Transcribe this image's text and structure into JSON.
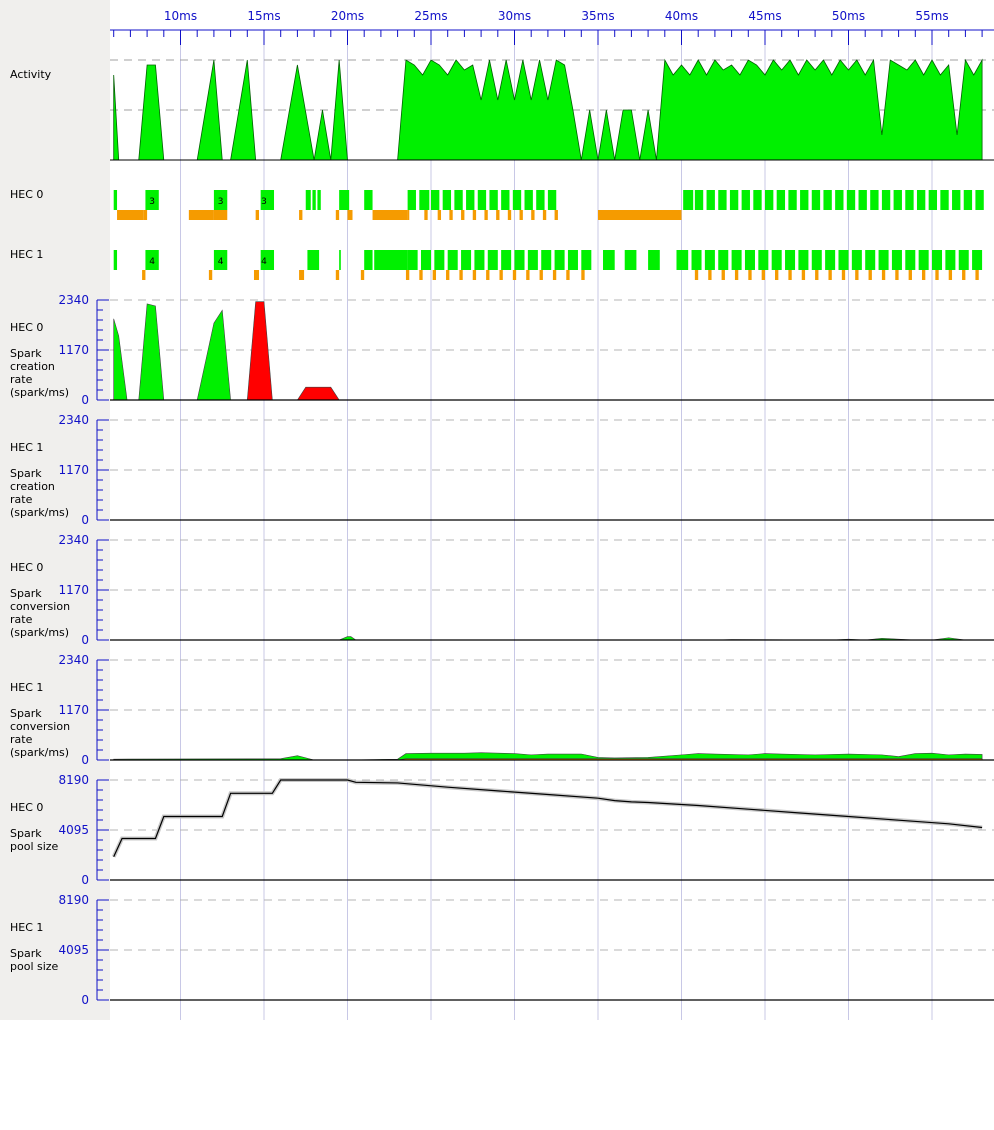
{
  "timeline": {
    "tick_labels": [
      "ms",
      "10ms",
      "15ms",
      "20ms",
      "25ms",
      "30ms",
      "35ms",
      "40ms",
      "45ms",
      "50ms",
      "55ms"
    ],
    "x_unit": "ms"
  },
  "rows": {
    "activity_label": "Activity",
    "hec0_label": "HEC 0",
    "hec1_label": "HEC 1"
  },
  "graph_labels": [
    {
      "hec": "HEC 0",
      "metric": "Spark\ncreation\nrate\n(spark/ms)"
    },
    {
      "hec": "HEC 1",
      "metric": "Spark\ncreation\nrate\n(spark/ms)"
    },
    {
      "hec": "HEC 0",
      "metric": "Spark\nconversion\nrate\n(spark/ms)"
    },
    {
      "hec": "HEC 1",
      "metric": "Spark\nconversion\nrate\n(spark/ms)"
    },
    {
      "hec": "HEC 0",
      "metric": "Spark\npool size"
    },
    {
      "hec": "HEC 1",
      "metric": "Spark\npool size"
    }
  ],
  "colors": {
    "running": "#00f000",
    "gc": "#f59b00",
    "overflow": "#ff0000",
    "axis": "#1010c8",
    "sidebar": "#f0efed"
  },
  "chart_data": [
    {
      "type": "area",
      "title": "Activity",
      "x": [
        6,
        6.3,
        6.8,
        7.5,
        8,
        8.5,
        9,
        10,
        11,
        12,
        12.5,
        13,
        14,
        14.5,
        15,
        16,
        17,
        18,
        18.5,
        19,
        19.5,
        20,
        20.5,
        21,
        22,
        23,
        23.5,
        24,
        24.5,
        25,
        25.5,
        26,
        26.5,
        27,
        27.5,
        28,
        28.5,
        29,
        29.5,
        30,
        30.5,
        31,
        31.5,
        32,
        32.5,
        33,
        33.5,
        34,
        34.5,
        35,
        35.5,
        36,
        36.5,
        37,
        37.5,
        38,
        38.5,
        39,
        39.5,
        40,
        40.5,
        41,
        41.5,
        42,
        42.5,
        43,
        43.5,
        44,
        44.5,
        45,
        45.5,
        46,
        46.5,
        47,
        47.5,
        48,
        48.5,
        49,
        49.5,
        50,
        50.5,
        51,
        51.5,
        52,
        52.5,
        53,
        53.5,
        54,
        54.5,
        55,
        55.5,
        56,
        56.5,
        57,
        57.5,
        58
      ],
      "y": [
        0.85,
        0,
        0,
        0,
        0.95,
        0.95,
        0,
        0,
        0,
        1,
        0,
        0,
        1,
        0,
        0,
        0,
        0.95,
        0,
        0.5,
        0,
        1,
        0,
        0,
        0,
        0,
        0,
        1,
        0.95,
        0.85,
        1,
        0.95,
        0.85,
        1,
        0.9,
        0.95,
        0.6,
        1,
        0.6,
        1,
        0.6,
        1,
        0.6,
        1,
        0.6,
        1,
        0.95,
        0.5,
        0,
        0.5,
        0,
        0.5,
        0,
        0.5,
        0.5,
        0,
        0.5,
        0,
        1,
        0.85,
        0.95,
        0.85,
        1,
        0.85,
        1,
        0.9,
        0.95,
        0.85,
        1,
        0.95,
        0.85,
        1,
        0.9,
        1,
        0.85,
        1,
        0.9,
        1,
        0.85,
        1,
        0.9,
        1,
        0.85,
        1,
        0.25,
        1,
        0.95,
        0.9,
        1,
        0.85,
        1,
        0.85,
        0.95,
        0.25,
        1,
        0.85,
        1
      ],
      "ylim": [
        0,
        1
      ],
      "grid": true
    },
    {
      "type": "line",
      "hec": "HEC 0",
      "metric": "Spark creation rate (spark/ms)",
      "ticks": [
        "2340",
        "1170",
        "0"
      ],
      "ylim": [
        0,
        2340
      ],
      "series": [
        {
          "color": "#00f000",
          "x": [
            6,
            6.3,
            6.8,
            7.5,
            8,
            8.5,
            9,
            10,
            11,
            12,
            12.5,
            13,
            14,
            14.5,
            15,
            15.5,
            16,
            19,
            20
          ],
          "y": [
            1900,
            1500,
            0,
            0,
            2250,
            2200,
            0,
            0,
            0,
            1800,
            2100,
            0,
            0,
            1200,
            1200,
            0,
            0,
            0,
            0
          ]
        },
        {
          "color": "#ff0000",
          "x": [
            14,
            14.5,
            15,
            15.5,
            16,
            17,
            17.5,
            19,
            19.5
          ],
          "y": [
            0,
            2300,
            2300,
            0,
            0,
            0,
            300,
            300,
            0
          ]
        }
      ]
    },
    {
      "type": "line",
      "hec": "HEC 1",
      "metric": "Spark creation rate (spark/ms)",
      "ticks": [
        "2340",
        "1170",
        "0"
      ],
      "ylim": [
        0,
        2340
      ],
      "series": []
    },
    {
      "type": "line",
      "hec": "HEC 0",
      "metric": "Spark conversion rate (spark/ms)",
      "ticks": [
        "2340",
        "1170",
        "0"
      ],
      "ylim": [
        0,
        2340
      ],
      "series": [
        {
          "color": "#00f000",
          "x": [
            19.5,
            20,
            20.2,
            20.5,
            25,
            38,
            42,
            43,
            49,
            50,
            51,
            52,
            54,
            55,
            56,
            57,
            58
          ],
          "y": [
            0,
            80,
            80,
            0,
            0,
            0,
            0,
            10,
            0,
            20,
            0,
            40,
            0,
            0,
            50,
            0,
            0
          ]
        }
      ]
    },
    {
      "type": "line",
      "hec": "HEC 1",
      "metric": "Spark conversion rate (spark/ms)",
      "ticks": [
        "2340",
        "1170",
        "0"
      ],
      "ylim": [
        0,
        2340
      ],
      "series": [
        {
          "color": "#00f000",
          "x": [
            6,
            16,
            17,
            18,
            20,
            23,
            23.5,
            25,
            27,
            28,
            30,
            31,
            32,
            34,
            35,
            36,
            38,
            40,
            41,
            42,
            44,
            45,
            46,
            48,
            50,
            52,
            53,
            54,
            55,
            56,
            57,
            58
          ],
          "y": [
            20,
            30,
            100,
            0,
            0,
            20,
            150,
            160,
            160,
            170,
            150,
            120,
            140,
            140,
            60,
            50,
            60,
            120,
            150,
            140,
            120,
            150,
            140,
            120,
            140,
            120,
            80,
            150,
            160,
            120,
            140,
            130
          ]
        },
        {
          "color": "#f59b00",
          "x": [
            20,
            23,
            23.5,
            58
          ],
          "y": [
            0,
            0,
            30,
            30
          ]
        }
      ]
    },
    {
      "type": "line",
      "hec": "HEC 0",
      "metric": "Spark pool size",
      "ticks": [
        "8190",
        "4095",
        "0"
      ],
      "ylim": [
        0,
        8190
      ],
      "series": [
        {
          "color": "#000000",
          "x": [
            6,
            6.5,
            8.5,
            9,
            12.5,
            13,
            15.5,
            16,
            20,
            20.5,
            23,
            26,
            29,
            32,
            35,
            36,
            37,
            38,
            41,
            44,
            47,
            50,
            53,
            56,
            58
          ],
          "y": [
            1900,
            3400,
            3400,
            5200,
            5200,
            7100,
            7100,
            8190,
            8190,
            8000,
            7950,
            7600,
            7300,
            7000,
            6700,
            6500,
            6400,
            6350,
            6100,
            5800,
            5500,
            5200,
            4900,
            4600,
            4300
          ]
        }
      ]
    },
    {
      "type": "line",
      "hec": "HEC 1",
      "metric": "Spark pool size",
      "ticks": [
        "8190",
        "4095",
        "0"
      ],
      "ylim": [
        0,
        8190
      ],
      "series": []
    },
    {
      "type": "timeline",
      "hec": "HEC 0",
      "running": [
        [
          6,
          6.2
        ],
        [
          7.9,
          8.7
        ],
        [
          12,
          12.8
        ],
        [
          14.8,
          15.6
        ],
        [
          17.5,
          17.8
        ],
        [
          17.9,
          18.1
        ],
        [
          18.2,
          18.4
        ],
        [
          19.5,
          20.1
        ],
        [
          21,
          21.5
        ],
        [
          23.6,
          24.1
        ],
        [
          24.3,
          24.9
        ],
        [
          25,
          25.5
        ],
        [
          25.7,
          26.2
        ],
        [
          26.4,
          26.9
        ],
        [
          27.1,
          27.6
        ],
        [
          27.8,
          28.3
        ],
        [
          28.5,
          29
        ],
        [
          29.2,
          29.7
        ],
        [
          29.9,
          30.4
        ],
        [
          30.6,
          31.1
        ],
        [
          31.3,
          31.8
        ],
        [
          32,
          32.5
        ],
        [
          40.1,
          40.7
        ],
        [
          40.8,
          41.3
        ],
        [
          41.5,
          42
        ],
        [
          42.2,
          42.7
        ],
        [
          42.9,
          43.4
        ],
        [
          43.6,
          44.1
        ],
        [
          44.3,
          44.8
        ],
        [
          45,
          45.5
        ],
        [
          45.7,
          46.2
        ],
        [
          46.4,
          46.9
        ],
        [
          47.1,
          47.6
        ],
        [
          47.8,
          48.3
        ],
        [
          48.5,
          49
        ],
        [
          49.2,
          49.7
        ],
        [
          49.9,
          50.4
        ],
        [
          50.6,
          51.1
        ],
        [
          51.3,
          51.8
        ],
        [
          52,
          52.5
        ],
        [
          52.7,
          53.2
        ],
        [
          53.4,
          53.9
        ],
        [
          54.1,
          54.6
        ],
        [
          54.8,
          55.3
        ],
        [
          55.5,
          56
        ],
        [
          56.2,
          56.7
        ],
        [
          56.9,
          57.4
        ],
        [
          57.6,
          58.1
        ]
      ],
      "gc": [
        [
          6.2,
          7.8
        ],
        [
          7.8,
          8
        ],
        [
          10.5,
          12
        ],
        [
          12,
          12.8
        ],
        [
          14.5,
          14.7
        ],
        [
          17.1,
          17.3
        ],
        [
          19.3,
          19.5
        ],
        [
          20,
          20.3
        ],
        [
          21.5,
          23.6
        ],
        [
          23.6,
          23.7
        ],
        [
          24.6,
          24.8
        ],
        [
          25.4,
          25.6
        ],
        [
          26.1,
          26.3
        ],
        [
          26.8,
          27
        ],
        [
          27.5,
          27.7
        ],
        [
          28.2,
          28.4
        ],
        [
          28.9,
          29.1
        ],
        [
          29.6,
          29.8
        ],
        [
          30.3,
          30.5
        ],
        [
          31,
          31.2
        ],
        [
          31.7,
          31.9
        ],
        [
          32.4,
          32.6
        ],
        [
          35,
          40
        ]
      ],
      "labels": [
        {
          "x": 8.3,
          "t": "3"
        },
        {
          "x": 12.4,
          "t": "3"
        },
        {
          "x": 15,
          "t": "3"
        }
      ]
    },
    {
      "type": "timeline",
      "hec": "HEC 1",
      "running": [
        [
          6,
          6.2
        ],
        [
          7.9,
          8.7
        ],
        [
          12,
          12.8
        ],
        [
          14.8,
          15.6
        ],
        [
          17.6,
          18.3
        ],
        [
          19.5,
          19.6
        ],
        [
          21,
          21.5
        ],
        [
          21.6,
          23.6
        ],
        [
          23.6,
          24.2
        ],
        [
          24.4,
          25
        ],
        [
          25.2,
          25.8
        ],
        [
          26,
          26.6
        ],
        [
          26.8,
          27.4
        ],
        [
          27.6,
          28.2
        ],
        [
          28.4,
          29
        ],
        [
          29.2,
          29.8
        ],
        [
          30,
          30.6
        ],
        [
          30.8,
          31.4
        ],
        [
          31.6,
          32.2
        ],
        [
          32.4,
          33
        ],
        [
          33.2,
          33.8
        ],
        [
          34,
          34.6
        ],
        [
          35.3,
          36
        ],
        [
          36.6,
          37.3
        ],
        [
          38,
          38.7
        ],
        [
          39.7,
          40.4
        ],
        [
          40.6,
          41.2
        ],
        [
          41.4,
          42
        ],
        [
          42.2,
          42.8
        ],
        [
          43,
          43.6
        ],
        [
          43.8,
          44.4
        ],
        [
          44.6,
          45.2
        ],
        [
          45.4,
          46
        ],
        [
          46.2,
          46.8
        ],
        [
          47,
          47.6
        ],
        [
          47.8,
          48.4
        ],
        [
          48.6,
          49.2
        ],
        [
          49.4,
          50
        ],
        [
          50.2,
          50.8
        ],
        [
          51,
          51.6
        ],
        [
          51.8,
          52.4
        ],
        [
          52.6,
          53.2
        ],
        [
          53.4,
          54
        ],
        [
          54.2,
          54.8
        ],
        [
          55,
          55.6
        ],
        [
          55.8,
          56.4
        ],
        [
          56.6,
          57.2
        ],
        [
          57.4,
          58
        ]
      ],
      "gc": [
        [
          7.7,
          7.9
        ],
        [
          11.7,
          11.9
        ],
        [
          14.4,
          14.7
        ],
        [
          17.1,
          17.4
        ],
        [
          19.3,
          19.5
        ],
        [
          20.8,
          21
        ],
        [
          23.5,
          23.7
        ],
        [
          24.3,
          24.5
        ],
        [
          25.1,
          25.3
        ],
        [
          25.9,
          26.1
        ],
        [
          26.7,
          26.9
        ],
        [
          27.5,
          27.7
        ],
        [
          28.3,
          28.5
        ],
        [
          29.1,
          29.3
        ],
        [
          29.9,
          30.1
        ],
        [
          30.7,
          30.9
        ],
        [
          31.5,
          31.7
        ],
        [
          32.3,
          32.5
        ],
        [
          33.1,
          33.3
        ],
        [
          34,
          34.2
        ],
        [
          40.8,
          41
        ],
        [
          41.6,
          41.8
        ],
        [
          42.4,
          42.6
        ],
        [
          43.2,
          43.4
        ],
        [
          44,
          44.2
        ],
        [
          44.8,
          45
        ],
        [
          45.6,
          45.8
        ],
        [
          46.4,
          46.6
        ],
        [
          47.2,
          47.4
        ],
        [
          48,
          48.2
        ],
        [
          48.8,
          49
        ],
        [
          49.6,
          49.8
        ],
        [
          50.4,
          50.6
        ],
        [
          51.2,
          51.4
        ],
        [
          52,
          52.2
        ],
        [
          52.8,
          53
        ],
        [
          53.6,
          53.8
        ],
        [
          54.4,
          54.6
        ],
        [
          55.2,
          55.4
        ],
        [
          56,
          56.2
        ],
        [
          56.8,
          57
        ],
        [
          57.6,
          57.8
        ]
      ],
      "labels": [
        {
          "x": 8.3,
          "t": "4"
        },
        {
          "x": 12.4,
          "t": "4"
        },
        {
          "x": 15,
          "t": "4"
        }
      ]
    }
  ]
}
